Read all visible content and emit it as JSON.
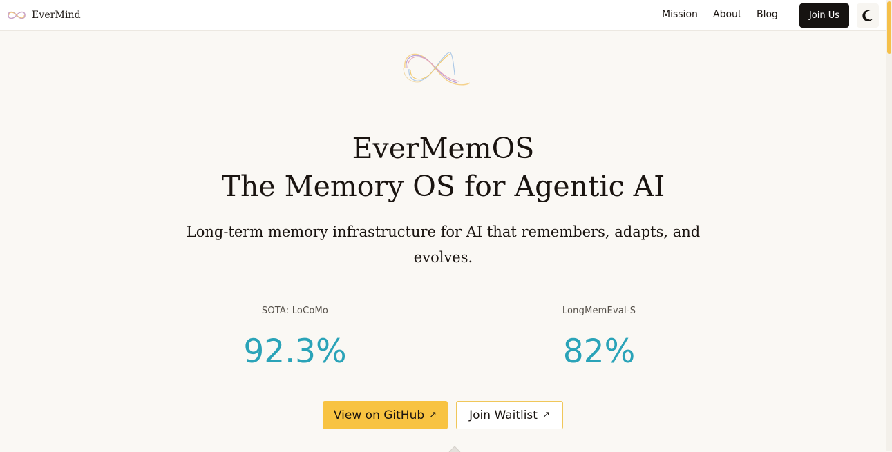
{
  "brand": {
    "name": "EverMind",
    "logo_icon": "infinity-logo-icon"
  },
  "nav": {
    "links": [
      "Mission",
      "About",
      "Blog"
    ],
    "join_label": "Join Us",
    "theme_icon": "moon-icon"
  },
  "hero": {
    "mark_icon": "infinity-ribbon-icon",
    "title_line1": "EverMemOS",
    "title_line2": "The Memory OS for Agentic AI",
    "subtitle": "Long-term memory infrastructure for AI that remembers, adapts, and evolves."
  },
  "stats": [
    {
      "label": "SOTA: LoCoMo",
      "value": "92.3%"
    },
    {
      "label": "LongMemEval-S",
      "value": "82%"
    }
  ],
  "cta": {
    "github_label": "View on GitHub",
    "waitlist_label": "Join Waitlist",
    "arrow_icon": "arrow-up-right-icon"
  },
  "colors": {
    "accent": "#f8c341",
    "stat": "#2aa3b8",
    "background": "#faf8f4",
    "dark_button": "#161311"
  }
}
